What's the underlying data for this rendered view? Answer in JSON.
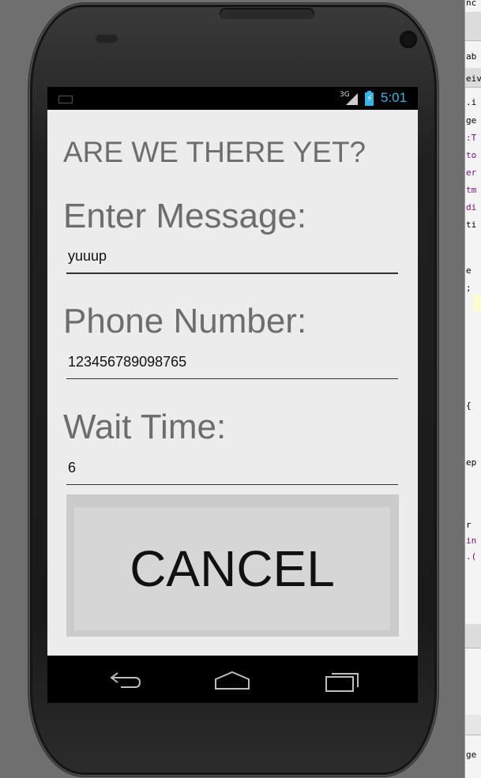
{
  "statusbar": {
    "network": "3G",
    "time": "5:01"
  },
  "app": {
    "title": "ARE WE THERE YET?",
    "message_label": "Enter Message:",
    "message_value": "yuuup",
    "phone_label": "Phone Number:",
    "phone_value": "123456789098765",
    "wait_label": "Wait Time:",
    "wait_value": "6",
    "cancel_label": "CANCEL"
  },
  "navbar": {
    "icons": [
      "back-icon",
      "home-icon",
      "recent-apps-icon"
    ]
  },
  "ide": {
    "lines": [
      "nc",
      "ab",
      "eiv",
      ".i",
      "ge",
      ":T",
      "to",
      "er",
      "tm",
      "di",
      "ti",
      "e",
      ";",
      "{",
      "ep",
      "r",
      "in",
      ".(",
      "ge"
    ]
  },
  "colors": {
    "accent": "#33b5e5",
    "screen_bg": "#ececec",
    "label": "#6d6d6d"
  }
}
